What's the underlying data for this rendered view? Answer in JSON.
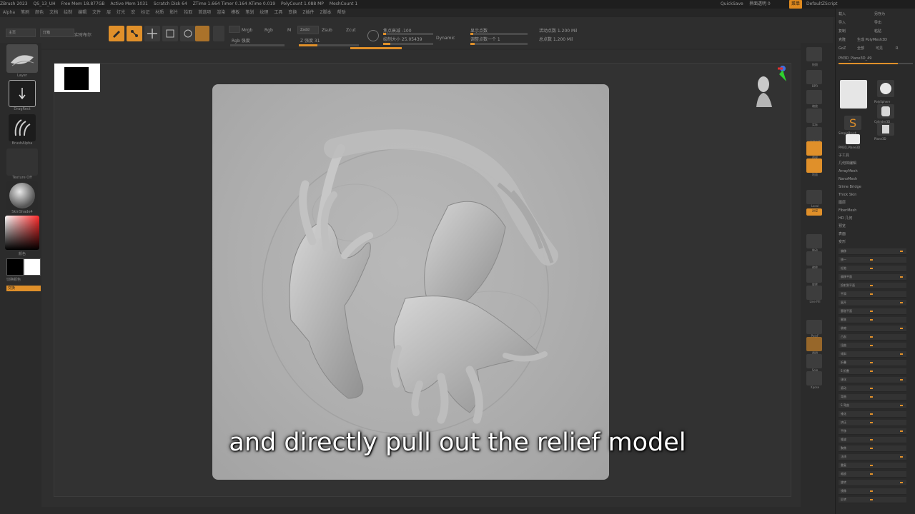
{
  "titlebar": {
    "items": [
      "ZBrush 2023",
      "QS_13_UH",
      "Free Mem 18.877GB",
      "Active Mem 1031",
      "Scratch Disk 64",
      "ZTime 1.664 Timer 0.164 ATime 0.019",
      "PolyCount 1.088 MP",
      "MeshCount 1"
    ],
    "quicksave": "QuickSave",
    "transp": "界面透明 0",
    "menus_btn": "菜单",
    "script": "DefaultZScript"
  },
  "menubar": {
    "items": [
      "Alpha",
      "笔刷",
      "颜色",
      "文档",
      "绘制",
      "编辑",
      "文件",
      "层",
      "灯光",
      "宏",
      "标记",
      "材质",
      "影片",
      "拾取",
      "首选项",
      "渲染",
      "模板",
      "笔划",
      "纹理",
      "工具",
      "变换",
      "Z插件",
      "Z脚本",
      "帮助"
    ]
  },
  "toolbar": {
    "home_label": "主页",
    "lightbox_label": "灯箱",
    "live_label": "实时布尔",
    "edit_label": "Edit",
    "draw_label": "Draw",
    "move_label": "Move",
    "scale_label": "Scale",
    "rotate_label": "Rotate",
    "mrgb": "Mrgb",
    "rgb": "Rgb",
    "m": "M",
    "zadd": "Zadd",
    "zsub": "Zsub",
    "zcut": "Zcut",
    "rgb_intensity": "Rgb 强度",
    "z_intensity": "Z 强度 31",
    "focal_shift": "焦点衰减 -100",
    "draw_size": "绘制大小 25.05439",
    "dynamic": "Dynamic",
    "active_points": "活动点数 1.200 Mil",
    "total_points": "总点数 1.200 Mil",
    "sym1": "显示点数",
    "sym2": "调整点数一个 1"
  },
  "left_shelf": {
    "items": [
      "Layer",
      "DragRect",
      "BrushAlpha",
      "Texture Off",
      "SkinShade4",
      "颜色"
    ],
    "switch_label": "切换颜色",
    "swap_label": "交换"
  },
  "right_shelf": {
    "items": [
      "快照",
      "BPR",
      "缩放",
      "实际",
      "AAHalf",
      "透视",
      "地面",
      "Local",
      "XYZ",
      "移动",
      "缩放",
      "旋转",
      "Line Fill",
      "PolyF",
      "透明",
      "Solo",
      "Xpose"
    ]
  },
  "right_panel": {
    "top_buttons": [
      "载入",
      "另存为",
      "导入",
      "导出",
      "复制",
      "粘贴",
      "克隆",
      "生成 PolyMesh3D",
      "GoZ",
      "全部",
      "可见",
      "R"
    ],
    "tool_name": "PM3D_Plane3D_49",
    "subtool_thumbs": [
      "PolySphere",
      "Cylinder3D",
      "SimpleBrush",
      "Plane3D",
      "PM3D_Plane3D"
    ],
    "list": [
      "子工具",
      "几何体编辑",
      "ArrayMesh",
      "NanoMesh",
      "Slime Bridge",
      "Thick Skin",
      "图层",
      "FiberMesh",
      "HD 几何",
      "预览",
      "表面",
      "变形"
    ],
    "deform_rows": [
      "偏移",
      "统一",
      "松弛",
      "偏移平面",
      "投射到平面",
      "平滑",
      "展开",
      "膨胀平面",
      "膨胀",
      "收缩",
      "凸起",
      "扭曲",
      "倾斜",
      "折叠",
      "S 折叠",
      "球化",
      "滚动",
      "弯曲",
      "S 弯曲",
      "锥化",
      "挤压",
      "平移",
      "噪波",
      "聚焦",
      "法线",
      "重复",
      "缩放",
      "旋转",
      "镜像",
      "反转"
    ]
  },
  "subtitle": "and directly pull out the relief model",
  "colors": {
    "accent": "#e0902a",
    "background": "#2b2b2b",
    "plane": "#b0b0b0"
  }
}
